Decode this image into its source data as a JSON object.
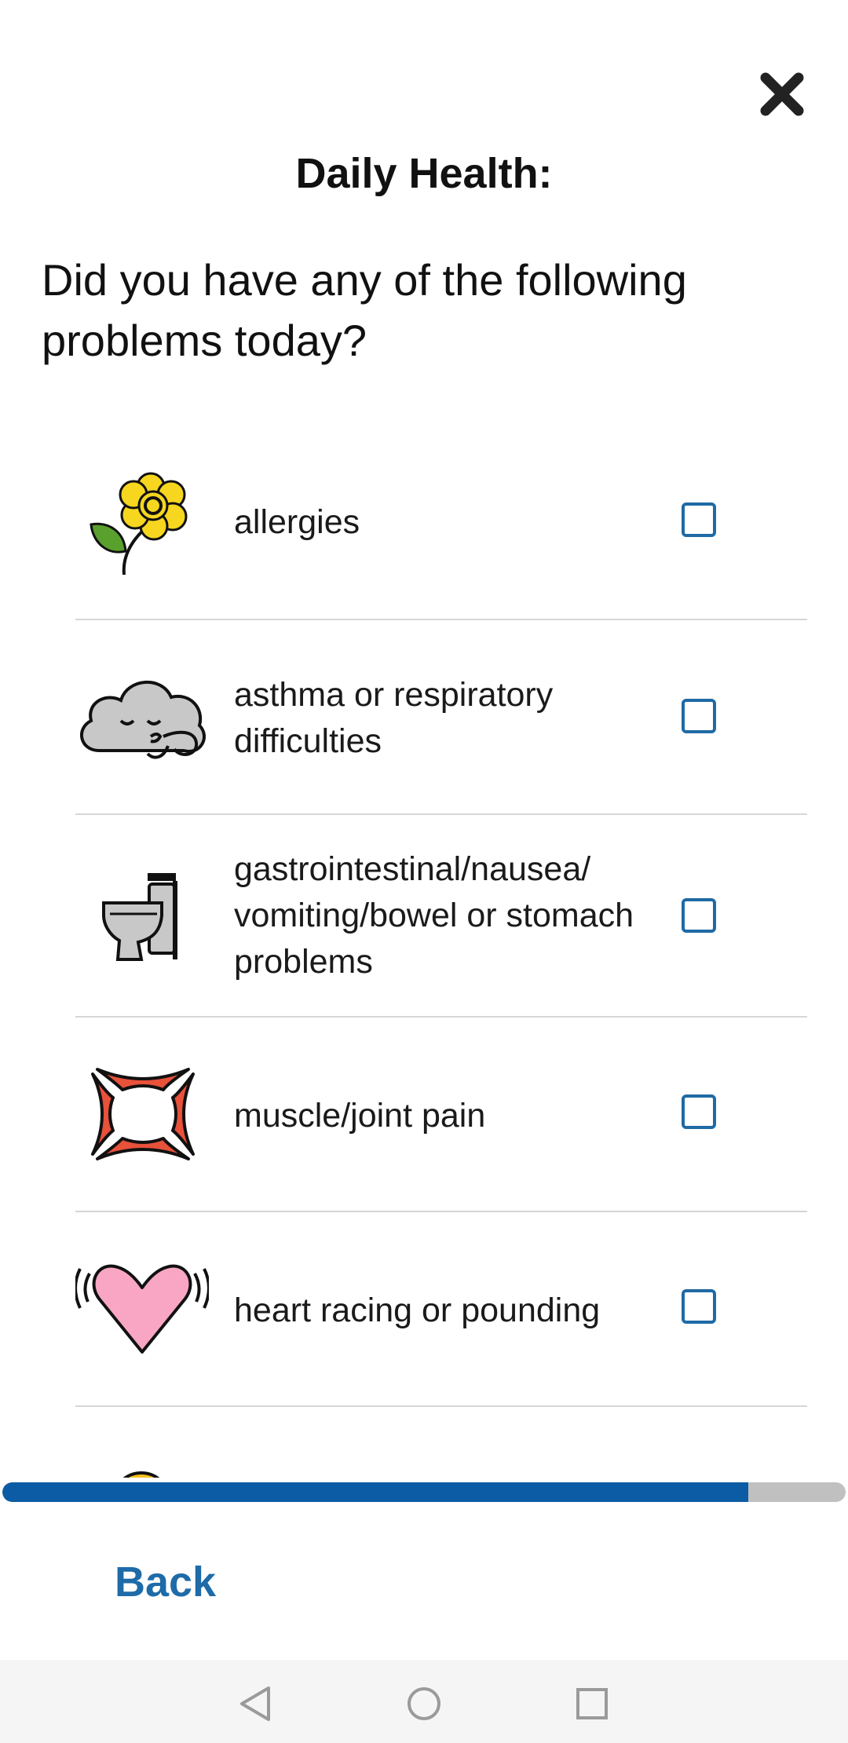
{
  "title": "Daily Health:",
  "question": "Did you have any of the following problems today?",
  "items": [
    {
      "label": "allergies",
      "icon": "flower-icon",
      "checked": false
    },
    {
      "label": "asthma or respiratory difficulties",
      "icon": "blowing-cloud-icon",
      "checked": false
    },
    {
      "label": "gastrointestinal/nausea/ vomiting/bowel or stomach problems",
      "icon": "toilet-icon",
      "checked": false
    },
    {
      "label": "muscle/joint pain",
      "icon": "anger-symbol-icon",
      "checked": false
    },
    {
      "label": "heart racing or pounding",
      "icon": "beating-heart-icon",
      "checked": false
    }
  ],
  "progress": {
    "fraction": 0.885
  },
  "footer": {
    "back_label": "Back"
  },
  "colors": {
    "accent": "#1e6ba8",
    "progress_fill": "#0b5ca4",
    "progress_track": "#c0c0c0",
    "checkbox_border": "#1f6aa5",
    "divider": "#d6d6d6"
  },
  "system_nav": {
    "icons": [
      "back-triangle-icon",
      "home-circle-icon",
      "recents-square-icon"
    ]
  }
}
